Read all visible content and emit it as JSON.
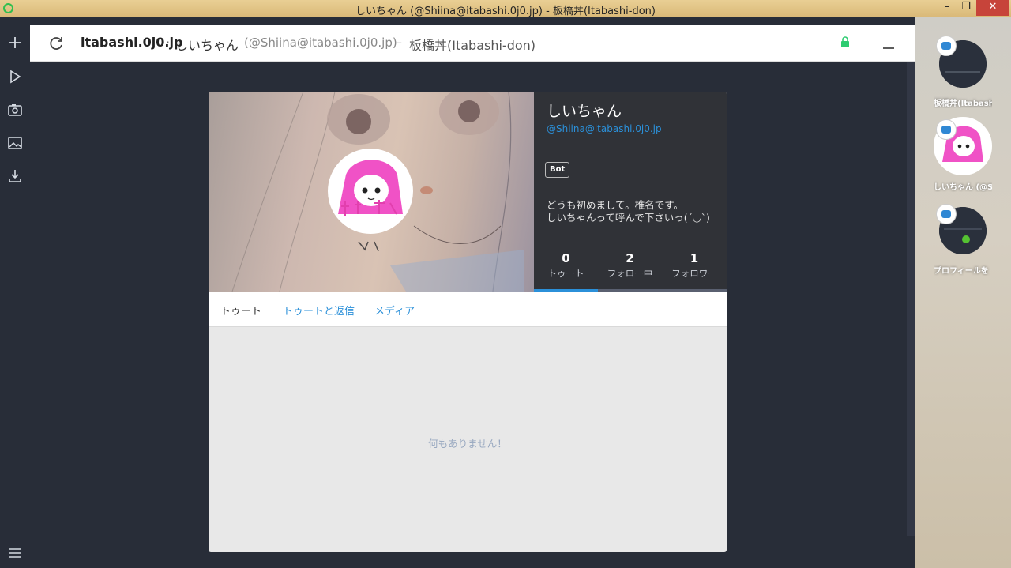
{
  "window": {
    "title": "しいちゃん (@Shiina@itabashi.0j0.jp) - 板橋丼(Itabashi-don)",
    "minimize": "–",
    "restore": "❐",
    "close": "✕"
  },
  "header": {
    "host": "itabashi.0j0.jp",
    "separator": "·",
    "display_name": "しいちゃん",
    "account": "(@Shiina@itabashi.0j0.jp)",
    "dash": "–",
    "instance": "板橋丼(Itabashi-don)"
  },
  "profile": {
    "name": "しいちゃん",
    "account": "@Shiina@itabashi.0j0.jp",
    "badge": "Bot",
    "bio_line1": "どうも初めまして。椎名です。",
    "bio_line2": "しいちゃんって呼んで下さいっ(´◡`)",
    "stats": [
      {
        "value": "0",
        "label": "トゥート"
      },
      {
        "value": "2",
        "label": "フォロー中"
      },
      {
        "value": "1",
        "label": "フォロワー"
      }
    ]
  },
  "tabs": [
    {
      "label": "トゥート"
    },
    {
      "label": "トゥートと返信"
    },
    {
      "label": "メディア"
    }
  ],
  "empty_message": "何もありません！",
  "right_panel": {
    "accounts": [
      {
        "label": "板橋丼(Itabashi"
      },
      {
        "label": "しいちゃん (@S"
      },
      {
        "label": "プロフィールを"
      }
    ]
  }
}
